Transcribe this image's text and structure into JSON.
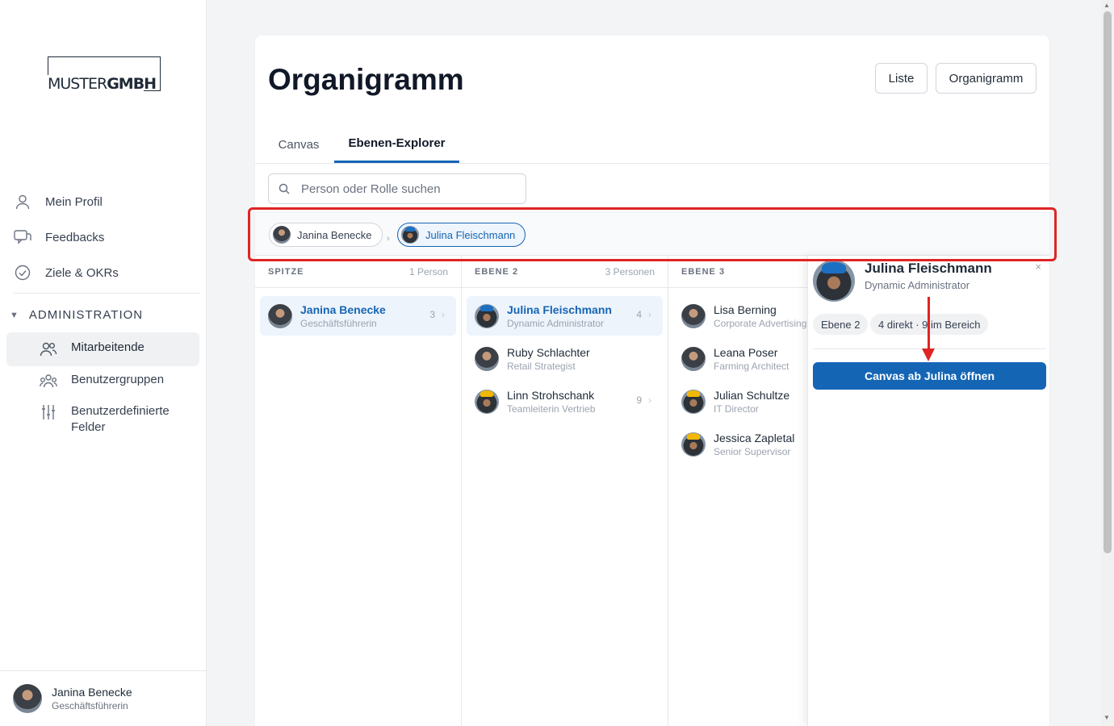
{
  "brand": {
    "logo_light": "MUSTER",
    "logo_bold": "GMBH"
  },
  "sidebar": {
    "items": [
      {
        "label": "Mein Profil",
        "icon": "user-icon"
      },
      {
        "label": "Feedbacks",
        "icon": "chat-icon"
      },
      {
        "label": "Ziele & OKRs",
        "icon": "check-circle-icon"
      }
    ],
    "admin_section": "ADMINISTRATION",
    "admin_items": [
      {
        "label": "Mitarbeitende",
        "icon": "users-icon",
        "active": true
      },
      {
        "label": "Benutzergruppen",
        "icon": "groups-icon"
      },
      {
        "label": "Benutzerdefinierte Felder",
        "icon": "sliders-icon"
      }
    ],
    "user": {
      "name": "Janina Benecke",
      "role": "Geschäftsführerin"
    }
  },
  "page": {
    "title": "Organigramm",
    "view_buttons": [
      "Liste",
      "Organigramm"
    ],
    "tabs": [
      "Canvas",
      "Ebenen-Explorer"
    ],
    "active_tab": "Ebenen-Explorer",
    "search_placeholder": "Person oder Rolle suchen"
  },
  "breadcrumb": [
    {
      "name": "Janina Benecke"
    },
    {
      "name": "Julina Fleischmann",
      "active": true
    }
  ],
  "columns": [
    {
      "label": "SPITZE",
      "count": "1 Person",
      "people": [
        {
          "name": "Janina Benecke",
          "role": "Geschäftsführerin",
          "reports": "3",
          "selected": true
        }
      ]
    },
    {
      "label": "EBENE 2",
      "count": "3 Personen",
      "people": [
        {
          "name": "Julina Fleischmann",
          "role": "Dynamic Administrator",
          "reports": "4",
          "selected": true
        },
        {
          "name": "Ruby Schlachter",
          "role": "Retail Strategist"
        },
        {
          "name": "Linn Strohschank",
          "role": "Teamleiterin Vertrieb",
          "reports": "9"
        }
      ]
    },
    {
      "label": "EBENE 3",
      "count": "",
      "people": [
        {
          "name": "Lisa Berning",
          "role": "Corporate Advertising"
        },
        {
          "name": "Leana Poser",
          "role": "Farming Architect"
        },
        {
          "name": "Julian Schultze",
          "role": "IT Director"
        },
        {
          "name": "Jessica Zapletal",
          "role": "Senior Supervisor"
        }
      ]
    }
  ],
  "detail": {
    "name": "Julina Fleischmann",
    "role": "Dynamic Administrator",
    "close": "×",
    "badges": [
      "Ebene 2",
      "4 direkt · 9 im Bereich"
    ],
    "cta": "Canvas ab Julina öffnen"
  },
  "colors": {
    "accent": "#1565b5",
    "annotation": "#e02424"
  }
}
